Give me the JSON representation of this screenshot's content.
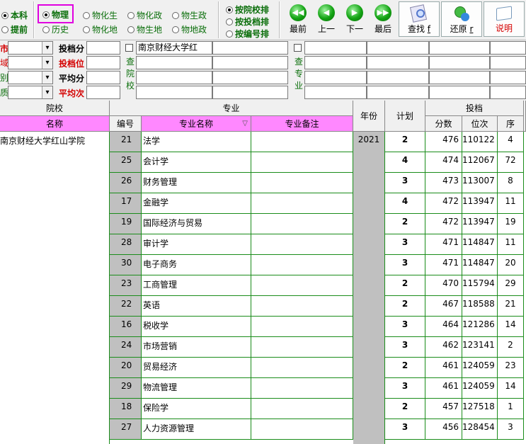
{
  "filters": {
    "level": [
      "本科",
      "提前"
    ],
    "subject_main": [
      "物理",
      "历史"
    ],
    "subject_pairs": [
      "物化生",
      "物化政",
      "物生政",
      "物化地",
      "物生地",
      "物地政"
    ],
    "sort_options": [
      "按院校排",
      "按投档排",
      "按编号排"
    ]
  },
  "nav": {
    "first": "最前",
    "prev": "上一",
    "next": "下一",
    "last": "最后"
  },
  "tools": {
    "search": "查找",
    "search_key": "f",
    "restore": "还原",
    "restore_key": "r",
    "help": "说明"
  },
  "search_panel": {
    "left_labels": [
      "市",
      "域",
      "别",
      "质"
    ],
    "stat_labels": [
      "投档分",
      "投档位",
      "平均分",
      "平均次"
    ],
    "college_label": [
      "查",
      "院",
      "校"
    ],
    "major_label": [
      "查",
      "专",
      "业"
    ],
    "college_query": "南京财经大学红"
  },
  "table": {
    "group_headers": {
      "college": "院校",
      "major": "专业",
      "year": "年份",
      "plan": "计划",
      "admission": "投档"
    },
    "sub_headers": {
      "name": "名称",
      "code": "编号",
      "major_name": "专业名称",
      "remark": "专业备注",
      "score": "分数",
      "rank": "位次",
      "seq": "序"
    },
    "college_name": "南京财经大学红山学院",
    "year": "2021",
    "rows": [
      {
        "code": "21",
        "major": "法学",
        "plan": "2",
        "score": "476",
        "rank": "110122",
        "seq": "4"
      },
      {
        "code": "25",
        "major": "会计学",
        "plan": "4",
        "score": "474",
        "rank": "112067",
        "seq": "72"
      },
      {
        "code": "26",
        "major": "财务管理",
        "plan": "3",
        "score": "473",
        "rank": "113007",
        "seq": "8"
      },
      {
        "code": "17",
        "major": "金融学",
        "plan": "4",
        "score": "472",
        "rank": "113947",
        "seq": "11"
      },
      {
        "code": "19",
        "major": "国际经济与贸易",
        "plan": "2",
        "score": "472",
        "rank": "113947",
        "seq": "19"
      },
      {
        "code": "28",
        "major": "审计学",
        "plan": "3",
        "score": "471",
        "rank": "114847",
        "seq": "11"
      },
      {
        "code": "30",
        "major": "电子商务",
        "plan": "3",
        "score": "471",
        "rank": "114847",
        "seq": "20"
      },
      {
        "code": "23",
        "major": "工商管理",
        "plan": "2",
        "score": "470",
        "rank": "115794",
        "seq": "29"
      },
      {
        "code": "22",
        "major": "英语",
        "plan": "2",
        "score": "467",
        "rank": "118588",
        "seq": "21"
      },
      {
        "code": "16",
        "major": "税收学",
        "plan": "3",
        "score": "464",
        "rank": "121286",
        "seq": "14"
      },
      {
        "code": "24",
        "major": "市场营销",
        "plan": "3",
        "score": "462",
        "rank": "123141",
        "seq": "2"
      },
      {
        "code": "20",
        "major": "贸易经济",
        "plan": "2",
        "score": "461",
        "rank": "124059",
        "seq": "23"
      },
      {
        "code": "29",
        "major": "物流管理",
        "plan": "3",
        "score": "461",
        "rank": "124059",
        "seq": "14"
      },
      {
        "code": "18",
        "major": "保险学",
        "plan": "2",
        "score": "457",
        "rank": "127518",
        "seq": "1"
      },
      {
        "code": "27",
        "major": "人力资源管理",
        "plan": "3",
        "score": "456",
        "rank": "128454",
        "seq": "3"
      }
    ]
  }
}
